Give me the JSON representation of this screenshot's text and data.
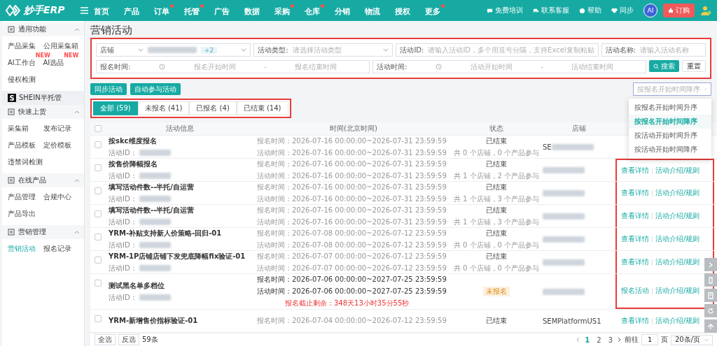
{
  "topbar": {
    "logo": "妙手ERP",
    "nav": [
      {
        "label": "首页",
        "dot": false
      },
      {
        "label": "产品",
        "dot": false
      },
      {
        "label": "订单",
        "dot": true
      },
      {
        "label": "托管",
        "dot": true
      },
      {
        "label": "广告",
        "dot": false
      },
      {
        "label": "数据",
        "dot": false
      },
      {
        "label": "采购",
        "dot": true
      },
      {
        "label": "仓库",
        "dot": true
      },
      {
        "label": "分销",
        "dot": false
      },
      {
        "label": "物流",
        "dot": false
      },
      {
        "label": "授权",
        "dot": false
      },
      {
        "label": "更多",
        "dot": true
      }
    ],
    "links": [
      "免费培训",
      "联系客服",
      "帮助",
      "同步"
    ],
    "ai": "AI",
    "order_button": "订购"
  },
  "sidebar": {
    "sections": [
      {
        "kind": "group",
        "title": "通用功能",
        "expanded": true,
        "items": [
          {
            "label": "产品采集",
            "selected": false
          },
          {
            "label": "公用采集箱",
            "selected": false
          },
          {
            "label": "AI工作台",
            "badge": "NEW",
            "selected": false
          },
          {
            "label": "AI选品",
            "badge": "NEW",
            "selected": false
          },
          {
            "label": "侵权检测",
            "selected": false
          }
        ]
      },
      {
        "kind": "brand",
        "title": "SHEIN半托管",
        "logo": "S"
      },
      {
        "kind": "group",
        "title": "快速上货",
        "expanded": true,
        "items": [
          {
            "label": "采集箱",
            "selected": false
          },
          {
            "label": "发布记录",
            "selected": false
          },
          {
            "label": "产品模板",
            "selected": false
          },
          {
            "label": "定价模板",
            "selected": false
          },
          {
            "label": "违禁词检测",
            "selected": false
          }
        ]
      },
      {
        "kind": "group",
        "title": "在线产品",
        "expanded": true,
        "items": [
          {
            "label": "产品管理",
            "selected": false
          },
          {
            "label": "合规中心",
            "selected": false
          },
          {
            "label": "产品导出",
            "selected": false
          }
        ]
      },
      {
        "kind": "group",
        "title": "营销管理",
        "expanded": true,
        "items": [
          {
            "label": "营销活动",
            "selected": true
          },
          {
            "label": "报名记录",
            "selected": false
          }
        ]
      }
    ]
  },
  "page_title": "营销活动",
  "filters": {
    "highlighted": true,
    "store": {
      "label": "店铺",
      "extra": "+2"
    },
    "type": {
      "label": "活动类型:",
      "placeholder": "请选择活动类型"
    },
    "id": {
      "label": "活动ID:",
      "placeholder": "请输入活动ID，多个用逗号分隔，支持Excel复制粘贴"
    },
    "name": {
      "label": "活动名称:",
      "placeholder": "请输入活动名称"
    },
    "signup_time": {
      "label": "报名时间:",
      "start": "报名开始时间",
      "separator": "-",
      "end": "报名结束时间"
    },
    "activity_time": {
      "label": "活动时间:",
      "start": "活动开始时间",
      "separator": "-",
      "end": "活动结束时间"
    },
    "search": "搜索",
    "reset": "重置"
  },
  "actions": [
    "同步活动",
    "自动参与活动"
  ],
  "tabs_highlighted": true,
  "tabs": [
    {
      "label": "全部 (59)",
      "selected": true
    },
    {
      "label": "未报名 (41)",
      "selected": false
    },
    {
      "label": "已报名 (4)",
      "selected": false
    },
    {
      "label": "已结束 (14)",
      "selected": false
    }
  ],
  "sort": {
    "placeholder": "按报名开始时间降序",
    "options": [
      {
        "label": "按报名开始时间升序",
        "selected": false
      },
      {
        "label": "按报名开始时间降序",
        "selected": true
      },
      {
        "label": "按活动开始时间升序",
        "selected": false
      },
      {
        "label": "按活动开始时间降序",
        "selected": false
      }
    ]
  },
  "table": {
    "columns": [
      "活动信息",
      "时间(北京时间)",
      "状态",
      "店铺"
    ],
    "header_checked": false,
    "rows": [
      {
        "checked": false,
        "name": "按skc维度报名",
        "id_label": "活动ID：",
        "times": [
          "报名时间：2026-07-16 00:00:00~2026-07-31 23:59:59",
          "活动时间：2026-07-16 00:00:00~2026-07-31 23:59:59"
        ],
        "status_tag": false,
        "status": "已结束",
        "summary": "共 0 个店铺，0 个产品参与",
        "store": "SE",
        "store_blurred": true,
        "links": [],
        "annotated": false
      },
      {
        "checked": false,
        "name": "按售价降幅报名",
        "id_label": "活动ID：",
        "times": [
          "报名时间：2026-07-16 00:00:00~2026-07-31 23:59:59",
          "活动时间：2026-07-16 00:00:00~2026-07-31 23:59:59"
        ],
        "status_tag": false,
        "status": "已结束",
        "summary": "共 1 个店铺，2 个产品参与",
        "store_blurred": true,
        "links": [
          "查看详情",
          "活动介绍/规则"
        ],
        "annotated": true
      },
      {
        "checked": false,
        "name": "填写活动件数--半托/自运营",
        "id_label": "活动ID：",
        "times": [
          "报名时间：2026-07-16 00:00:00~2026-07-31 23:59:59",
          "活动时间：2026-07-16 00:00:00~2026-07-31 23:59:59"
        ],
        "status_tag": false,
        "status": "已结束",
        "summary": "共 1 个店铺，3 个产品参与",
        "store_blurred": true,
        "links": [
          "查看详情",
          "活动介绍/规则"
        ],
        "annotated": true
      },
      {
        "checked": false,
        "name": "填写活动件数--半托/自运营",
        "id_label": "活动ID：",
        "times": [
          "报名时间：2026-07-16 00:00:00~2026-07-31 23:59:59",
          "活动时间：2026-07-16 00:00:00~2026-07-31 23:59:59"
        ],
        "status_tag": false,
        "status": "已结束",
        "summary": "共 1 个店铺，3 个产品参与",
        "store_blurred": true,
        "links": [
          "查看详情",
          "活动介绍/规则"
        ],
        "annotated": true
      },
      {
        "checked": false,
        "name": "YRM-补贴支持新人价策略-回归-01",
        "id_label": "活动ID：",
        "times": [
          "报名时间：2026-07-08 00:00:00~2026-07-12 23:59:59",
          "活动时间：2026-07-08 00:00:00~2026-07-12 23:59:59"
        ],
        "status_tag": false,
        "status": "已结束",
        "summary": "共 0 个店铺，0 个产品参与",
        "store_blurred": true,
        "links": [
          "查看详情",
          "活动介绍/规则"
        ],
        "annotated": true
      },
      {
        "checked": false,
        "name": "YRM-1P店铺店铺下发兜底降幅fix验证-01",
        "id_label": "活动ID：",
        "times": [
          "报名时间：2026-07-07 00:00:00~2026-07-12 23:59:59",
          "活动时间：2026-07-07 00:00:00~2026-07-12 23:59:59"
        ],
        "status_tag": false,
        "status": "已结束",
        "summary": "共 0 个店铺，0 个产品参与",
        "store_blurred": true,
        "links": [
          "查看详情",
          "活动介绍/规则"
        ],
        "annotated": true
      },
      {
        "checked": false,
        "name": "测试黑名单多档位",
        "id_label": "活动ID：",
        "times": [
          "报名时间：2026-07-06 00:00:00~2027-07-25 23:59:59",
          "活动时间：2026-07-06 00:00:00~2027-07-25 23:59:59"
        ],
        "countdown": "报名截止剩余：348天13小时35分55秒",
        "status_tag": true,
        "status": "未报名",
        "store_blurred": true,
        "links": [
          "报名活动",
          "活动介绍/规则"
        ],
        "annotated": true
      },
      {
        "checked": false,
        "name": "YRM-新增售价指标验证-01",
        "times": [
          "报名时间：2026-07-04 00:00:00~2026-07-12 23:59:59"
        ],
        "status_tag": false,
        "status": "已结束",
        "store": "SEMPlatformUS1",
        "store_blurred": false,
        "links": [
          "查看详情",
          "活动介绍/规则"
        ],
        "annotated": false
      }
    ]
  },
  "footer": {
    "select_all": "全选",
    "invert": "反选",
    "count": "59条",
    "pages": [
      {
        "label": "1",
        "selected": true
      },
      {
        "label": "2",
        "selected": false
      },
      {
        "label": "3",
        "selected": false
      }
    ],
    "goto": "前往",
    "page_value": "1",
    "page_unit": "页",
    "page_size": "20条/页"
  }
}
